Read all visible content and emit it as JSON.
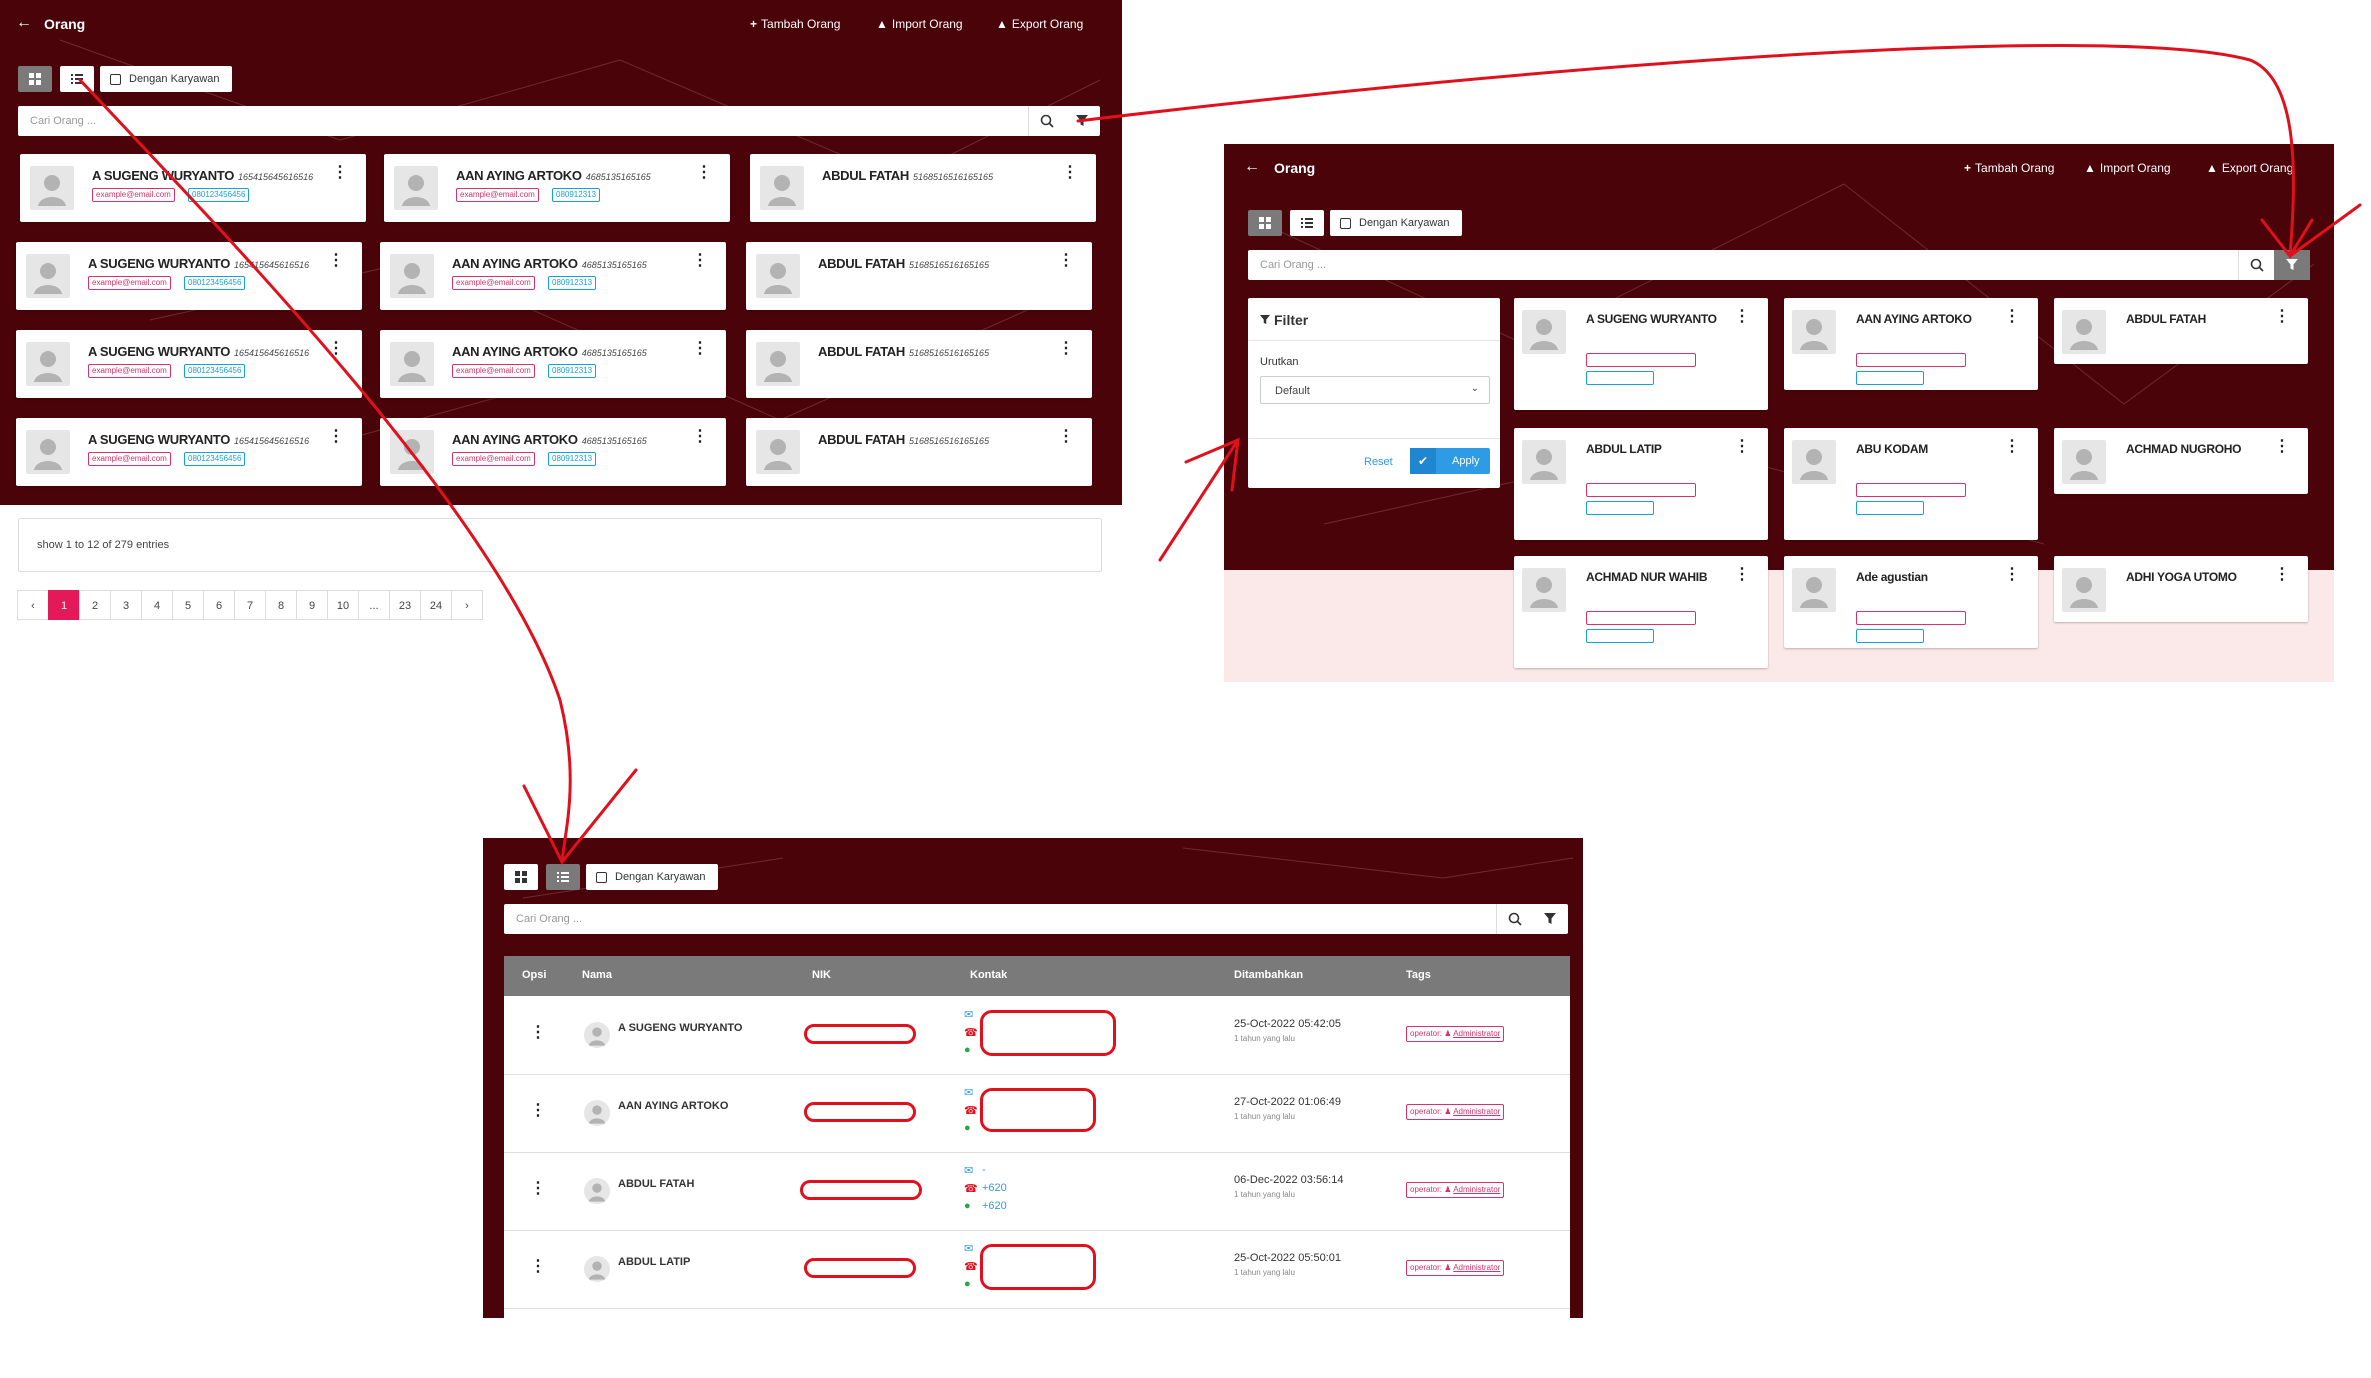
{
  "header": {
    "title": "Orang",
    "add_label": "Tambah Orang",
    "import_label": "Import Orang",
    "export_label": "Export Orang"
  },
  "toolbar": {
    "employee_checkbox_label": "Dengan Karyawan",
    "search_placeholder": "Cari Orang ..."
  },
  "grid_cards": [
    {
      "name": "A SUGENG WURYANTO",
      "nik": "165415645616516",
      "email": "example@email.com",
      "phone": "080123456456"
    },
    {
      "name": "AAN AYING ARTOKO",
      "nik": "4685135165165",
      "email": "example@email.com",
      "phone": "080912313"
    },
    {
      "name": "ABDUL FATAH",
      "nik": "5168516516165165",
      "email": "",
      "phone": ""
    },
    {
      "name": "A SUGENG WURYANTO",
      "nik": "165415645616516",
      "email": "example@email.com",
      "phone": "080123456456"
    },
    {
      "name": "AAN AYING ARTOKO",
      "nik": "4685135165165",
      "email": "example@email.com",
      "phone": "080912313"
    },
    {
      "name": "ABDUL FATAH",
      "nik": "5168516516165165",
      "email": "",
      "phone": ""
    },
    {
      "name": "A SUGENG WURYANTO",
      "nik": "165415645616516",
      "email": "example@email.com",
      "phone": "080123456456"
    },
    {
      "name": "AAN AYING ARTOKO",
      "nik": "4685135165165",
      "email": "example@email.com",
      "phone": "080912313"
    },
    {
      "name": "ABDUL FATAH",
      "nik": "5168516516165165",
      "email": "",
      "phone": ""
    },
    {
      "name": "A SUGENG WURYANTO",
      "nik": "165415645616516",
      "email": "example@email.com",
      "phone": "080123456456"
    },
    {
      "name": "AAN AYING ARTOKO",
      "nik": "4685135165165",
      "email": "example@email.com",
      "phone": "080912313"
    },
    {
      "name": "ABDUL FATAH",
      "nik": "5168516516165165",
      "email": "",
      "phone": ""
    }
  ],
  "entries_info": "show 1 to 12 of 279 entries",
  "pagination": [
    "‹",
    "1",
    "2",
    "3",
    "4",
    "5",
    "6",
    "7",
    "8",
    "9",
    "10",
    "...",
    "23",
    "24",
    "›"
  ],
  "pagination_active": "1",
  "filter": {
    "title": "Filter",
    "sort_label": "Urutkan",
    "sort_value": "Default",
    "reset_label": "Reset",
    "apply_label": "Apply"
  },
  "filtered_cards": [
    {
      "name": "A SUGENG WURYANTO"
    },
    {
      "name": "AAN AYING ARTOKO"
    },
    {
      "name": "ABDUL FATAH"
    },
    {
      "name": "ABDUL LATIP"
    },
    {
      "name": "ABU KODAM"
    },
    {
      "name": "ACHMAD NUGROHO"
    },
    {
      "name": "ACHMAD NUR WAHIB"
    },
    {
      "name": "Ade agustian"
    },
    {
      "name": "ADHI YOGA UTOMO"
    }
  ],
  "table": {
    "columns": [
      "Opsi",
      "Nama",
      "NIK",
      "Kontak",
      "Ditambahkan",
      "Tags"
    ],
    "rows": [
      {
        "name": "A SUGENG WURYANTO",
        "added": "25-Oct-2022 05:42:05",
        "ago": "1 tahun yang lalu",
        "tag_prefix": "operator:",
        "tag_value": "Administrator",
        "contacts": [
          "",
          "",
          ""
        ]
      },
      {
        "name": "AAN AYING ARTOKO",
        "added": "27-Oct-2022 01:06:49",
        "ago": "1 tahun yang lalu",
        "tag_prefix": "operator:",
        "tag_value": "Administrator",
        "contacts": [
          "",
          "",
          ""
        ]
      },
      {
        "name": "ABDUL FATAH",
        "added": "06-Dec-2022 03:56:14",
        "ago": "1 tahun yang lalu",
        "tag_prefix": "operator:",
        "tag_value": "Administrator",
        "contacts": [
          "-",
          "+620",
          "+620"
        ]
      },
      {
        "name": "ABDUL LATIP",
        "added": "25-Oct-2022 05:50:01",
        "ago": "1 tahun yang lalu",
        "tag_prefix": "operator:",
        "tag_value": "Administrator",
        "contacts": [
          "",
          "",
          ""
        ]
      }
    ]
  },
  "colors": {
    "panel_bg": "#4a0309",
    "accent_pink": "#e4195a",
    "accent_blue": "#17a2d6",
    "annotation_red": "#e0101c",
    "apply_blue": "#2e9be6"
  }
}
